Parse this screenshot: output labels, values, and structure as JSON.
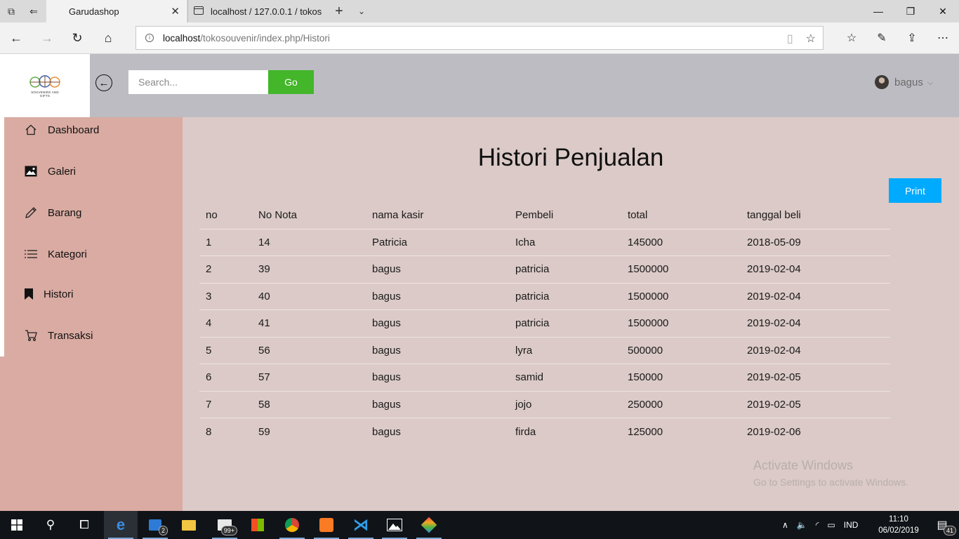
{
  "browser": {
    "tabs": [
      {
        "label": "Garudashop",
        "active": true
      },
      {
        "label": "localhost / 127.0.0.1 / tokos",
        "active": false
      }
    ],
    "url_host": "localhost",
    "url_path": "/tokosouvenir/index.php/Histori"
  },
  "header": {
    "logo_text": "SOUVENIRS AND GIFTS",
    "search_placeholder": "Search...",
    "go_label": "Go",
    "user_name": "bagus"
  },
  "sidebar": {
    "items": [
      {
        "label": "Dashboard",
        "icon": "home-icon"
      },
      {
        "label": "Galeri",
        "icon": "image-icon"
      },
      {
        "label": "Barang",
        "icon": "pencil-icon"
      },
      {
        "label": "Kategori",
        "icon": "list-icon"
      },
      {
        "label": "Histori",
        "icon": "bookmark-icon"
      },
      {
        "label": "Transaksi",
        "icon": "cart-icon"
      }
    ]
  },
  "main": {
    "title": "Histori Penjualan",
    "print_label": "Print",
    "table": {
      "columns": [
        "no",
        "No Nota",
        "nama kasir",
        "Pembeli",
        "total",
        "tanggal beli"
      ],
      "rows": [
        [
          "1",
          "14",
          "Patricia",
          "Icha",
          "145000",
          "2018-05-09"
        ],
        [
          "2",
          "39",
          "bagus",
          "patricia",
          "1500000",
          "2019-02-04"
        ],
        [
          "3",
          "40",
          "bagus",
          "patricia",
          "1500000",
          "2019-02-04"
        ],
        [
          "4",
          "41",
          "bagus",
          "patricia",
          "1500000",
          "2019-02-04"
        ],
        [
          "5",
          "56",
          "bagus",
          "lyra",
          "500000",
          "2019-02-04"
        ],
        [
          "6",
          "57",
          "bagus",
          "samid",
          "150000",
          "2019-02-05"
        ],
        [
          "7",
          "58",
          "bagus",
          "jojo",
          "250000",
          "2019-02-05"
        ],
        [
          "8",
          "59",
          "bagus",
          "firda",
          "125000",
          "2019-02-06"
        ]
      ]
    },
    "watermark_line1": "Activate Windows",
    "watermark_line2": "Go to Settings to activate Windows."
  },
  "taskbar": {
    "mail_badge": "2",
    "store_badge": "99+",
    "lang": "IND",
    "time": "11:10",
    "date": "06/02/2019",
    "notif_count": "41"
  },
  "colors": {
    "sidebar_bg": "#d9aba2",
    "main_bg": "#dbcac7",
    "header_bg": "#bdbcc2",
    "go_button": "#43b62a",
    "print_button": "#00aaff"
  }
}
